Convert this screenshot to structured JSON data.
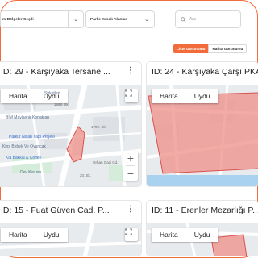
{
  "filters": {
    "region_select": "m Bölgeler Seçili",
    "parking_select": "Parke Yasak Alanlar",
    "search_placeholder": "Ara"
  },
  "view_toggle": {
    "list_label": "Liste Görünümü",
    "map_label": "Harita Görünümü"
  },
  "cards": [
    {
      "title": "ID: 29 - Karşıyaka Tersane ...",
      "map_type_options": [
        "Harita",
        "Uydu"
      ],
      "poi_labels": [
        "Şirketleri",
        "BİM Mavişehir Konakları",
        "Parkur Nisan Yapı Projesi",
        "Kirpi Bebek Ve Oyuncak",
        "Kia Bakkal & Coffee",
        "Dev Kurusu"
      ],
      "street_labels": [
        "1688. Sk.",
        "1709. Sk.",
        "Orhan Gazi Cd.",
        "20. Sk."
      ]
    },
    {
      "title": "ID: 24 - Karşıyaka Çarşı PKA",
      "map_type_options": [
        "Harita",
        "Uydu"
      ],
      "poi_labels": [],
      "street_labels": []
    },
    {
      "title": "ID: 15 - Fuat Güven Cad. P...",
      "map_type_options": [
        "Harita",
        "Uydu"
      ]
    },
    {
      "title": "ID: 11 - Erenler Mezarlığı P...",
      "map_type_options": [
        "Harita",
        "Uydu"
      ]
    }
  ],
  "colors": {
    "accent": "#f26b3a",
    "polygon_fill": "#ef8f87",
    "polygon_stroke": "#d9534f"
  }
}
